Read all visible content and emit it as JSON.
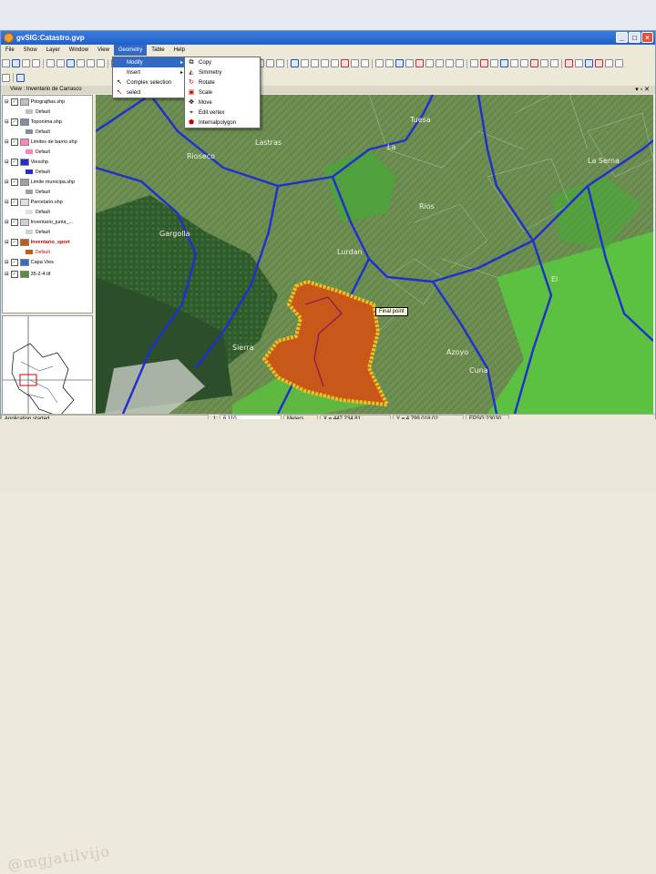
{
  "window": {
    "title": "gvSIG:Catastro.gvp"
  },
  "menubar": [
    "File",
    "Show",
    "Layer",
    "Window",
    "View",
    "Geometry",
    "Table",
    "Help"
  ],
  "view": {
    "title": "View : Inventario de Carrasco"
  },
  "geometry_menu": {
    "items": [
      "Modify",
      "Insert",
      "Complex selection",
      "select"
    ]
  },
  "modify_submenu": {
    "items": [
      "Copy",
      "Simmetry",
      "Rotate",
      "Scale",
      "Move",
      "Edit vertex",
      "Internalpolygon"
    ]
  },
  "layers": [
    {
      "name": "Pitograjfias.shp",
      "legend": "Default",
      "checked": true
    },
    {
      "name": "Toponima.shp",
      "legend": "Default",
      "checked": true
    },
    {
      "name": "Limites de barrio.shp",
      "legend": "Default",
      "checked": true
    },
    {
      "name": "Viesshp",
      "legend": "Default",
      "checked": true
    },
    {
      "name": "Limite municipa.shp",
      "legend": "Default",
      "checked": true
    },
    {
      "name": "Parcelario.shp",
      "legend": "Default",
      "checked": true
    },
    {
      "name": "Inventario_junia_...",
      "legend": "Default",
      "checked": true
    },
    {
      "name": "Inventario_sport",
      "legend": "Default",
      "checked": true
    },
    {
      "name": "Capa Vies",
      "legend": "",
      "checked": true
    },
    {
      "name": "35-2-4.tif",
      "legend": "",
      "checked": true
    }
  ],
  "map": {
    "place_labels": [
      "La",
      "Rioseco",
      "Lastras",
      "Gargolla",
      "Lurdan",
      "Sierra",
      "Rios",
      "Azoyo",
      "Cuna",
      "El",
      "La Serna",
      "Tuesa"
    ],
    "tooltip": "Final point"
  },
  "status": {
    "message": "Application started",
    "scale_label": "1:",
    "scale": "6.110",
    "units": "Meters",
    "x": "X = 447,234.81",
    "y": "Y = 4,799,018.02",
    "crs": "EPSG:23030"
  },
  "colors": {
    "roads": "#1f2fd0",
    "parcel": "#c8581a",
    "parcel_border": "#f0c020",
    "meadow": "#5cc040",
    "titlebar": "#2a68d5"
  },
  "watermark": "@mgjatilvijo"
}
